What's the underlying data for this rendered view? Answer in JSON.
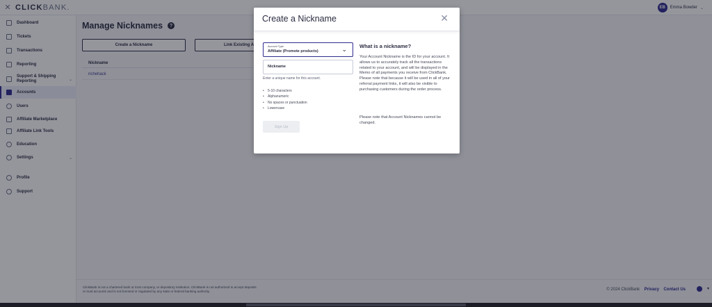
{
  "brand": {
    "logo_main": "CLICK",
    "logo_sub": "BANK."
  },
  "user": {
    "initials": "EB",
    "name": "Emma Bowder"
  },
  "sidebar": {
    "items": [
      {
        "label": "Dashboard"
      },
      {
        "label": "Tickets"
      },
      {
        "label": "Transactions"
      },
      {
        "label": "Reporting"
      },
      {
        "label": "Support & Shipping Reporting",
        "line1": "Support & Shipping",
        "line2": "Reporting"
      },
      {
        "label": "Accounts",
        "active": true
      },
      {
        "label": "Users"
      },
      {
        "label": "Affiliate Marketplace"
      },
      {
        "label": "Affiliate Link Tools"
      },
      {
        "label": "Education"
      },
      {
        "label": "Settings"
      },
      {
        "label": "Profile"
      },
      {
        "label": "Support"
      }
    ]
  },
  "main": {
    "title": "Manage Nicknames",
    "create_button": "Create a Nickname",
    "link_button": "Link Existing A",
    "table": {
      "header": "Nickname",
      "rows": [
        "richehack"
      ]
    }
  },
  "footer": {
    "disclaimer": "ClickBank is not a chartered bank or trust company, or depository institution. ClickBank is not authorized to accept deposits or trust accounts and is not licensed or regulated by any state or federal banking authority.",
    "copyright": "© 2024 ClickBank",
    "privacy": "Privacy",
    "contact": "Contact Us"
  },
  "modal": {
    "title": "Create a Nickname",
    "account_type_label": "Account Type",
    "account_type_value": "Affiliate (Promote products)",
    "nickname_placeholder": "Nickname",
    "helper": "Enter a unique name for this account.",
    "rules": [
      "5-10 characters",
      "Alphanumeric",
      "No spaces or punctuation",
      "Lowercase"
    ],
    "signup_button": "Sign Up",
    "info_title": "What is a nickname?",
    "info_body": "Your Account Nickname is the ID for your account. It allows us to accurately track all the transactions related to your account, and will be displayed in the Memo of all payments you receive from ClickBank. Please note that because it will be used in all of your referral payment links, it will also be visible to purchasing customers during the order process.",
    "info_note": "Please note that Account Nicknames cannot be changed."
  },
  "colors": {
    "accent": "#2f2a8e",
    "text": "#2b2d42",
    "overlay": "rgba(20,22,35,0.45)"
  }
}
